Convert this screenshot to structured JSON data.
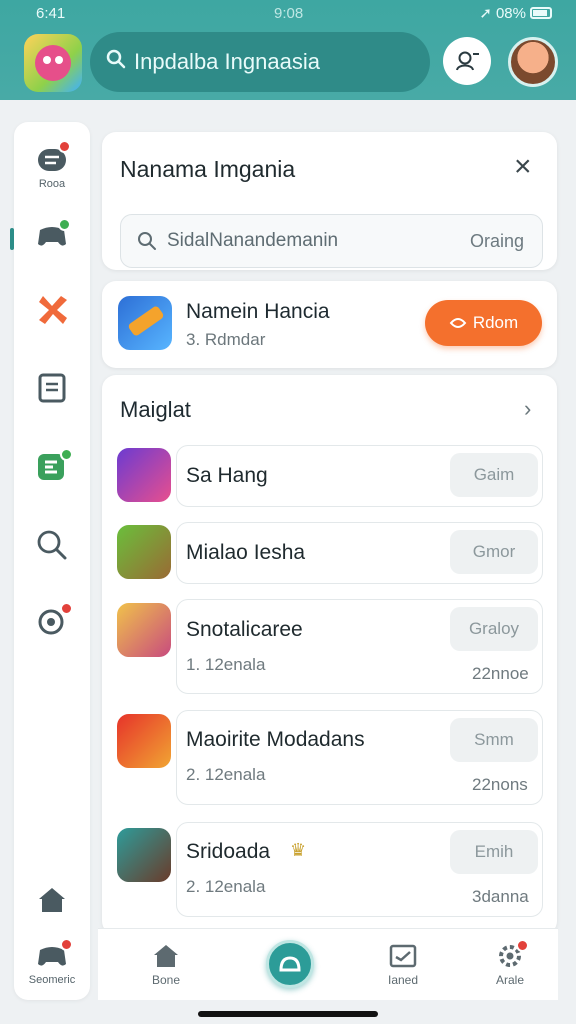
{
  "status": {
    "time": "6:41",
    "center": "9:08",
    "battery": "08%"
  },
  "search": {
    "value": "Inpdalba Ingnaasia"
  },
  "panel": {
    "title": "Nanama Imgania",
    "search_placeholder": "SidalNanandemanin",
    "search_hint": "Oraing"
  },
  "featured": {
    "title": "Namein Hancia",
    "subtitle": "3. Rdmdar",
    "button_label": "Rdom"
  },
  "list": {
    "title": "Maiglat",
    "items": [
      {
        "name": "Sa Hang",
        "button": "Gaim",
        "sub": "",
        "count": ""
      },
      {
        "name": "Mialao Iesha",
        "button": "Gmor",
        "sub": "",
        "count": ""
      },
      {
        "name": "Snotalicaree",
        "button": "Graloy",
        "sub": "1. 12enala",
        "count": "22nnoe"
      },
      {
        "name": "Maoirite Modadans",
        "button": "Smm",
        "sub": "2. 12enala",
        "count": "22nons"
      },
      {
        "name": "Sridoada",
        "button": "Emih",
        "sub": "2. 12enala",
        "count": "3danna"
      }
    ]
  },
  "sidebar": {
    "top_label": "Rooa",
    "bottom_label": "Seomeric"
  },
  "bottom_nav": {
    "items": [
      {
        "label": "Bone"
      },
      {
        "label": "Ianed"
      },
      {
        "label": "Arale"
      }
    ]
  },
  "colors": {
    "header": "#48aaa6",
    "accent_orange": "#f4702d",
    "fab": "#2c9c98"
  }
}
